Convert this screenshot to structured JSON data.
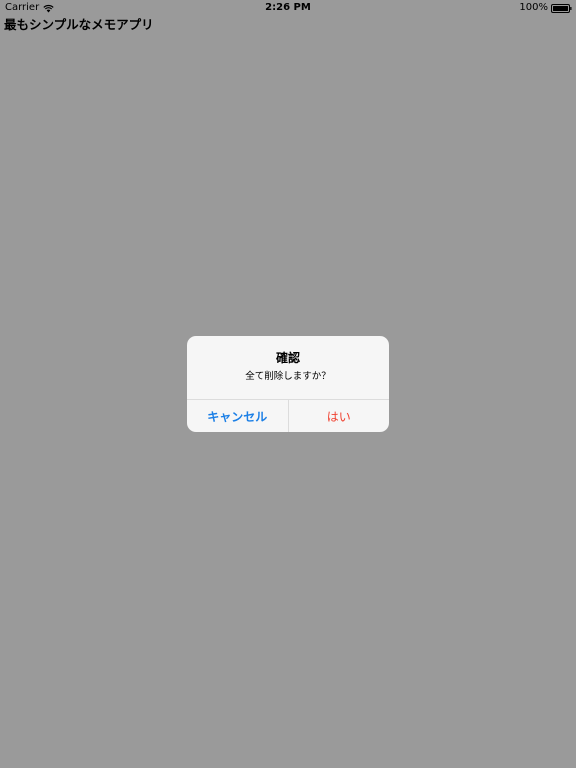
{
  "status_bar": {
    "carrier": "Carrier",
    "time": "2:26 PM",
    "battery": "100%"
  },
  "app": {
    "title": "最もシンプルなメモアプリ"
  },
  "alert": {
    "title": "確認",
    "message": "全て削除しますか？",
    "cancel_label": "キャンセル",
    "confirm_label": "はい"
  },
  "colors": {
    "background_dim": "#9a9a9a",
    "cancel_blue": "#1b7fe6",
    "destructive_red": "#f0402f"
  },
  "icons": [
    "wifi-icon",
    "battery-icon"
  ]
}
